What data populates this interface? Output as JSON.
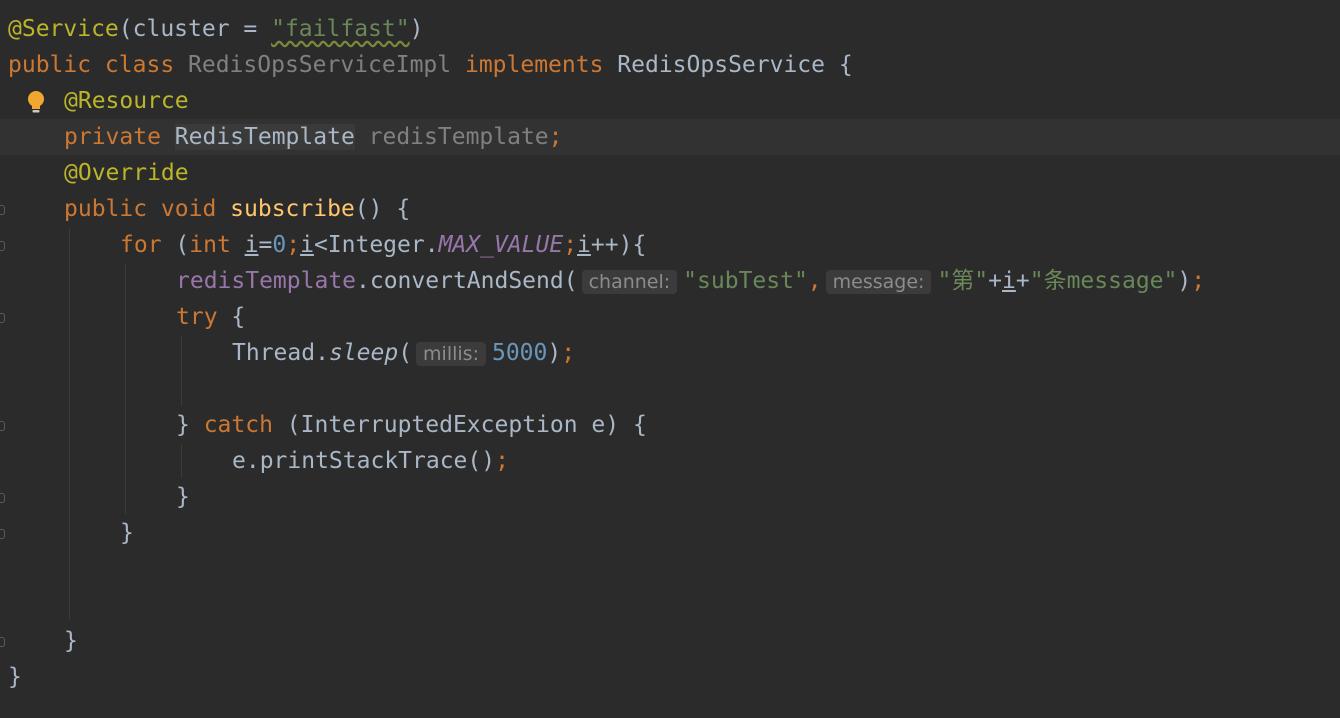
{
  "editor": {
    "theme_colors": {
      "background": "#2b2b2b",
      "keyword": "#cc7832",
      "annotation": "#bbb529",
      "string": "#6a8759",
      "number": "#6897bb",
      "field": "#9876aa",
      "method_decl": "#ffc66d",
      "text": "#a9b7c6"
    },
    "lines": {
      "l1": {
        "ann": "@Service",
        "p1": "(cluster = ",
        "str": "\"failfast\"",
        "p2": ")"
      },
      "l2": {
        "kw1": "public class ",
        "cls": "RedisOpsServiceImpl",
        "kw2": " implements ",
        "iface": "RedisOpsService {"
      },
      "l3": {
        "ann": "@Resource"
      },
      "l4": {
        "kw": "private ",
        "type": "RedisTemplate",
        "field": " redisTemplate",
        "semi": ";"
      },
      "l5": {
        "ann": "@Override"
      },
      "l6": {
        "kw": "public void ",
        "method": "subscribe",
        "p": "() {"
      },
      "l7": {
        "kw1": "for ",
        "p1": "(",
        "kw2": "int ",
        "var1": "i",
        "op1": "=",
        "num": "0",
        "semi1": ";",
        "var2": "i",
        "op2": "<Integer.",
        "const": "MAX_VALUE",
        "semi2": ";",
        "var3": "i",
        "p2": "++){"
      },
      "l8": {
        "field": "redisTemplate",
        "call": ".convertAndSend(",
        "hint1": "channel:",
        "str1": "\"subTest\"",
        "comma": ",",
        "hint2": "message:",
        "str2": "\"第\"",
        "plus1": "+",
        "var": "i",
        "plus2": "+",
        "str3": "\"条message\"",
        "end": ")",
        "semi": ";"
      },
      "l9": {
        "kw": "try ",
        "p": "{"
      },
      "l10": {
        "cls": "Thread.",
        "method": "sleep",
        "p1": "(",
        "hint": "millis:",
        "num": "5000",
        "p2": ")",
        "semi": ";"
      },
      "l12": {
        "p1": "} ",
        "kw": "catch ",
        "p2": "(InterruptedException e) {"
      },
      "l13": {
        "call": "e.printStackTrace()",
        "semi": ";"
      },
      "l14": {
        "p": "}"
      },
      "l15": {
        "p": "}"
      },
      "l18": {
        "p": "}"
      },
      "l19": {
        "p": "}"
      }
    }
  }
}
